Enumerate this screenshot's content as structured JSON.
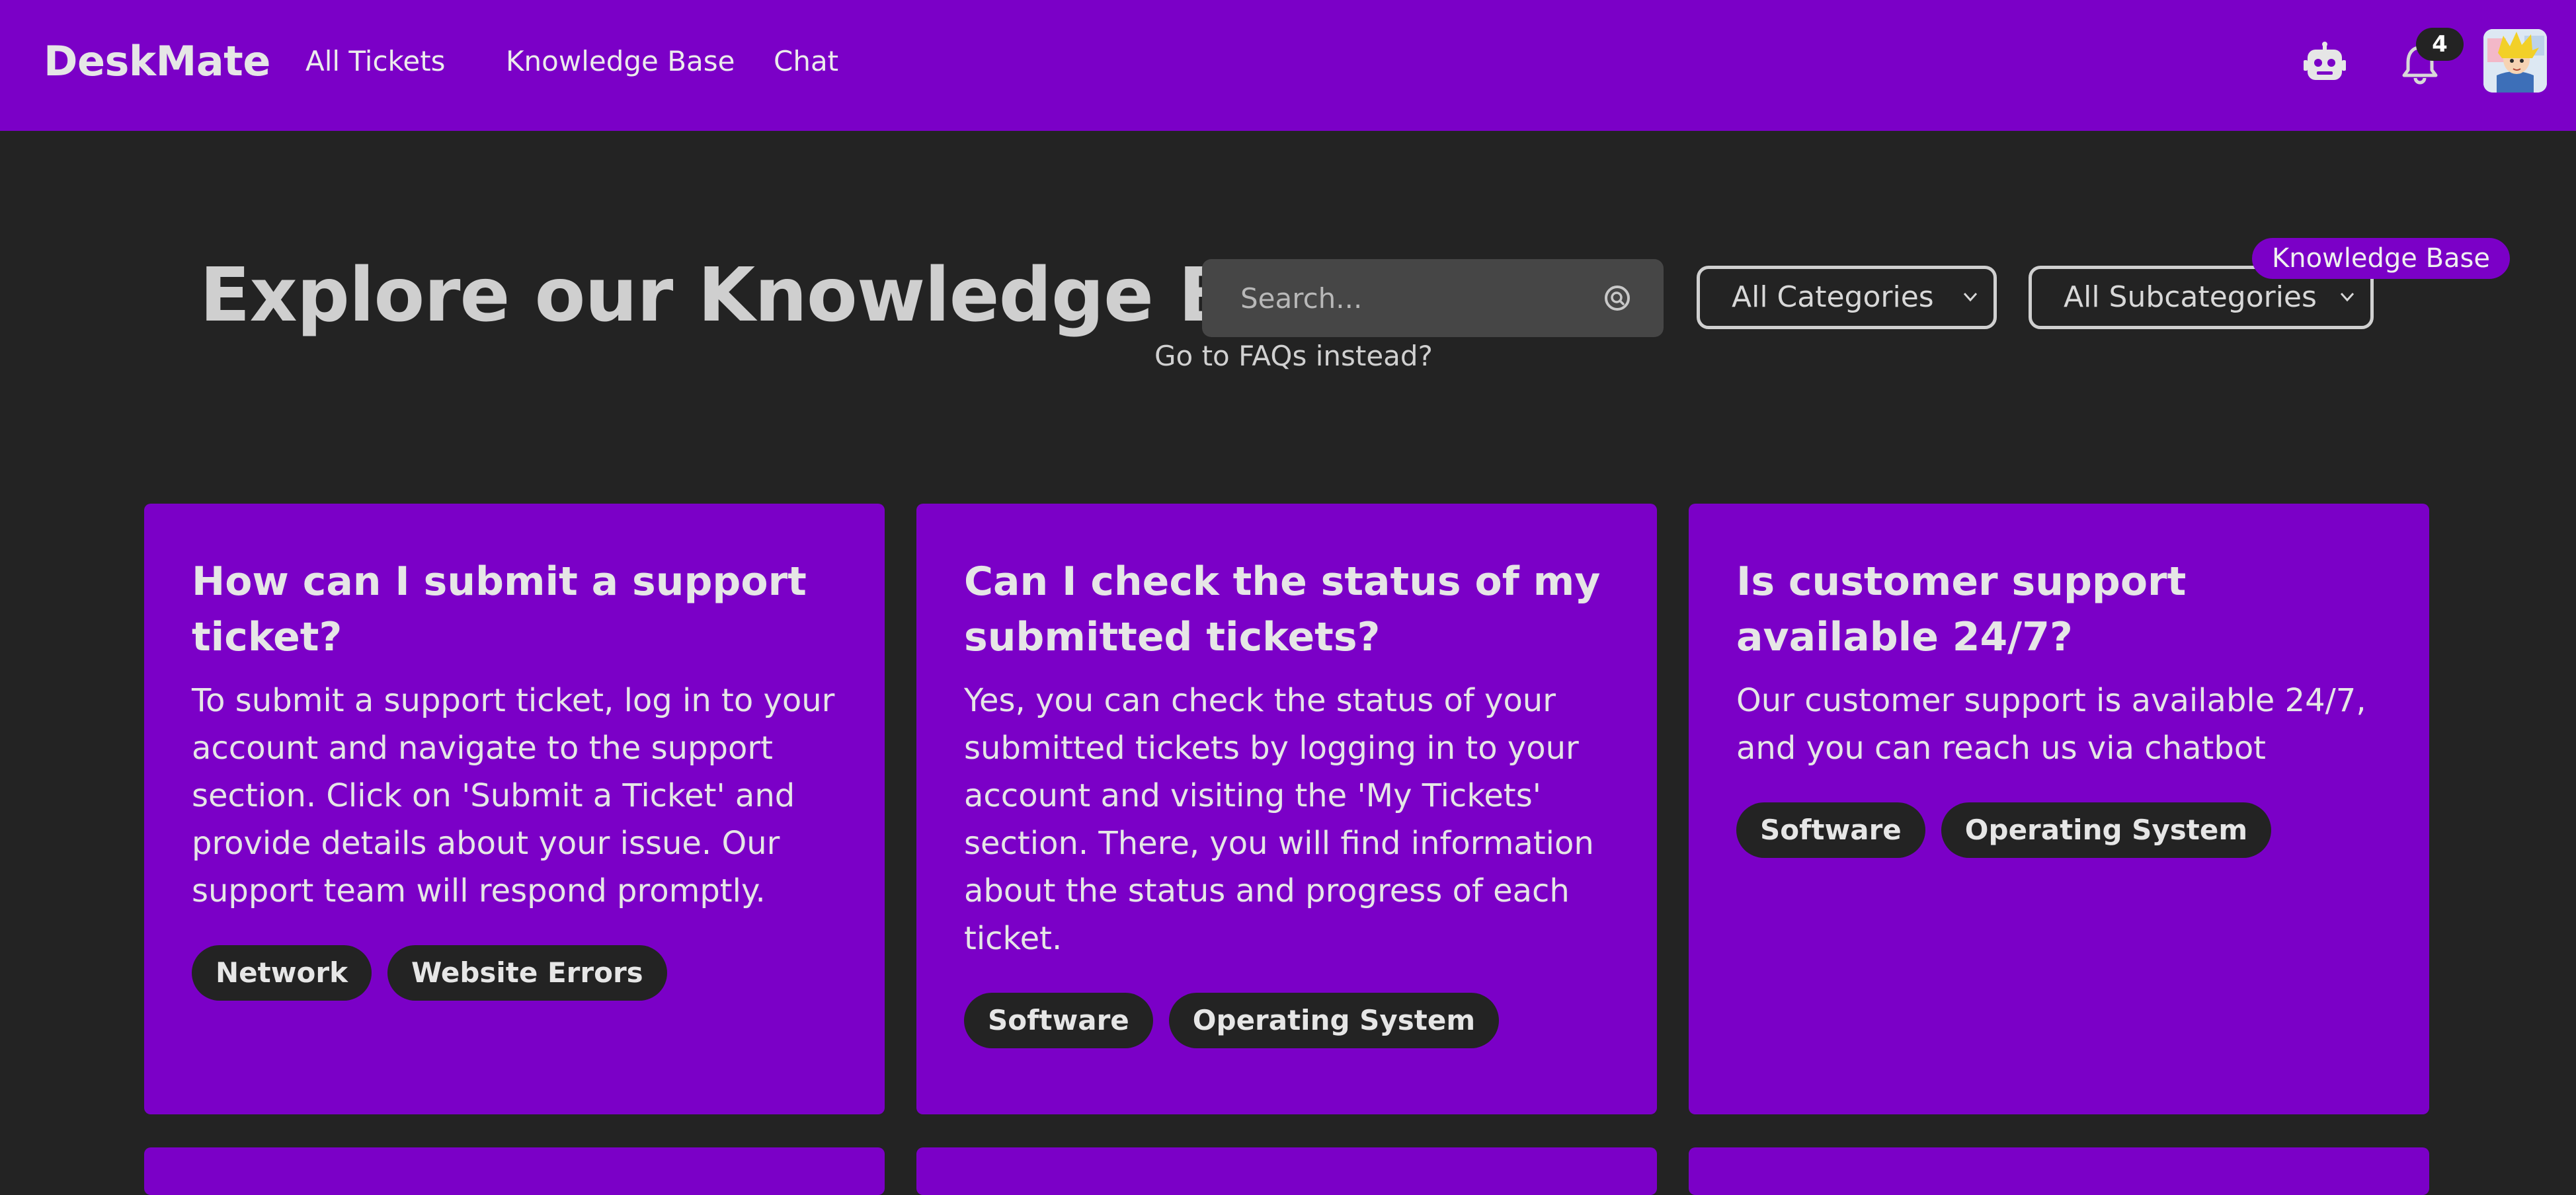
{
  "navbar": {
    "brand": "DeskMate",
    "links": [
      "All Tickets",
      "Knowledge Base",
      "Chat"
    ],
    "notification_count": "4",
    "bg_color": "#7b00c7"
  },
  "icons": {
    "robot": "robot-icon",
    "bell": "bell-icon",
    "search": "search-icon",
    "chevron": "chevron-down-icon"
  },
  "hero": {
    "title": "Explore our Knowledge Base",
    "search_placeholder": "Search...",
    "faq_link": "Go to FAQs instead?",
    "category_select": "All Categories",
    "subcategory_select": "All Subcategories",
    "section_chip": "Knowledge Base"
  },
  "articles": [
    {
      "title": "How can I submit a support ticket?",
      "body": "To submit a support ticket, log in to your account and navigate to the support section. Click on 'Submit a Ticket' and provide details about your issue. Our support team will respond promptly.",
      "tags": [
        "Network",
        "Website Errors"
      ]
    },
    {
      "title": "Can I check the status of my submitted tickets?",
      "body": "Yes, you can check the status of your submitted tickets by logging in to your account and visiting the 'My Tickets' section. There, you will find information about the status and progress of each ticket.",
      "tags": [
        "Software",
        "Operating System"
      ]
    },
    {
      "title": "Is customer support available 24/7?",
      "body": "Our customer support is available 24/7, and you can reach us via chatbot",
      "tags": [
        "Software",
        "Operating System"
      ]
    }
  ]
}
